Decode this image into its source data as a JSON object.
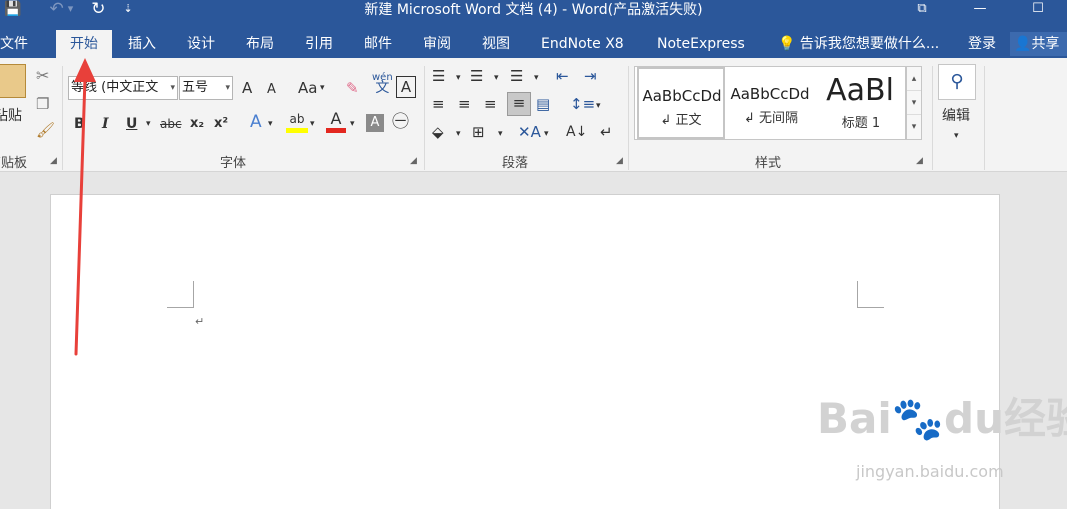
{
  "title_bar": {
    "title": "新建 Microsoft Word 文档 (4) - Word(产品激活失败)",
    "qat": {
      "save": "💾",
      "undo": "↶",
      "undo_menu": "▾",
      "redo": "↻",
      "customize": "⇣"
    },
    "window_controls": {
      "restore_ribbon": "⧉",
      "minimize": "—",
      "maximize": "☐"
    }
  },
  "tabs": [
    {
      "label": "文件"
    },
    {
      "label": "开始"
    },
    {
      "label": "插入"
    },
    {
      "label": "设计"
    },
    {
      "label": "布局"
    },
    {
      "label": "引用"
    },
    {
      "label": "邮件"
    },
    {
      "label": "审阅"
    },
    {
      "label": "视图"
    },
    {
      "label": "EndNote X8"
    },
    {
      "label": "NoteExpress"
    }
  ],
  "tell_me": "告诉我您想要做什么...",
  "login": "登录",
  "share": "共享",
  "ribbon": {
    "clipboard": {
      "label": "剪贴板",
      "paste": "粘贴"
    },
    "font": {
      "label": "字体",
      "font_name": "等线 (中文正文",
      "font_size": "五号",
      "grow": "A",
      "shrink": "A",
      "change_case": "Aa",
      "bold": "B",
      "italic": "I",
      "underline": "U",
      "strike": "abc",
      "subscript": "x₂",
      "superscript": "x²",
      "text_effects": "A",
      "highlight": "ab",
      "font_color": "A",
      "char_shading": "A",
      "enclose": "㊀",
      "phonetic_top": "wén",
      "phonetic_bottom": "文",
      "char_border": "A"
    },
    "paragraph": {
      "label": "段落"
    },
    "styles": {
      "label": "样式",
      "items": [
        {
          "sample": "AaBbCcDd",
          "name": "↲ 正文"
        },
        {
          "sample": "AaBbCcDd",
          "name": "↲ 无间隔"
        },
        {
          "sample": "AaBl",
          "name": "标题 1"
        }
      ]
    },
    "editing": {
      "label": "编辑"
    }
  },
  "document": {
    "paragraph_mark": "↵"
  },
  "watermark": {
    "main": "Bai🐾du经验",
    "sub": "jingyan.baidu.com"
  },
  "colors": {
    "accent": "#2b579a",
    "arrow": "#e8403a"
  }
}
